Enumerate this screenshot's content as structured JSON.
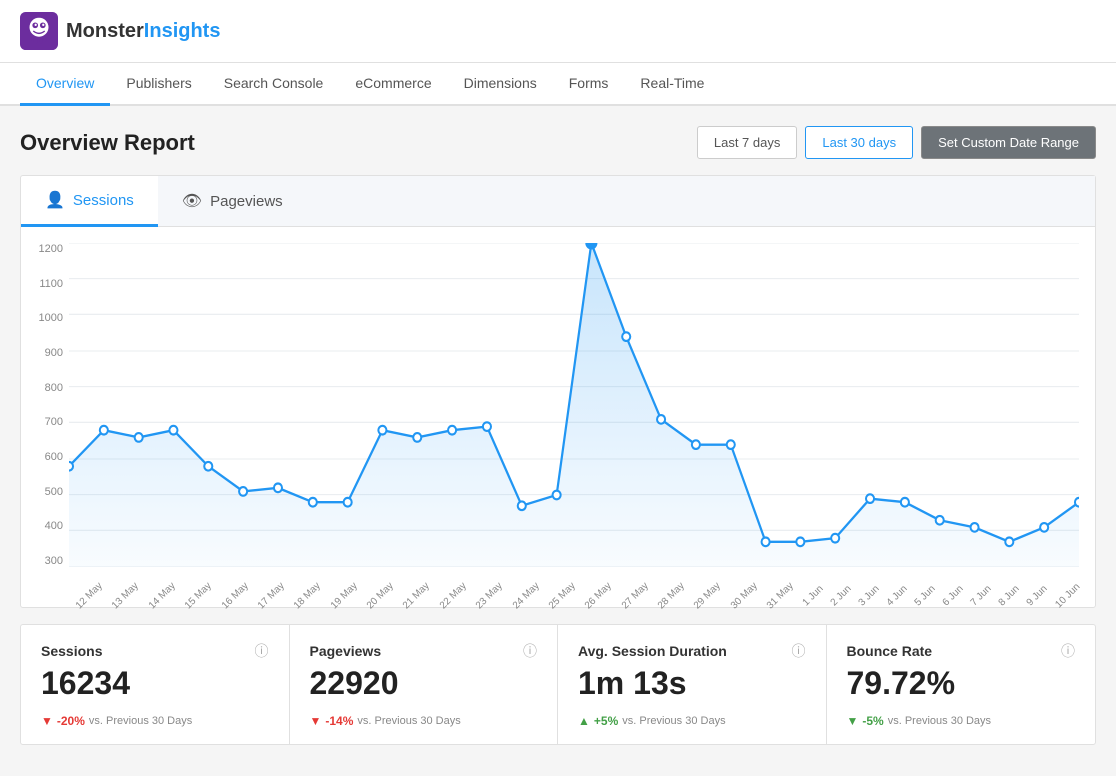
{
  "header": {
    "logo_monster": "Monster",
    "logo_insights": "Insights"
  },
  "nav": {
    "items": [
      {
        "id": "overview",
        "label": "Overview",
        "active": true
      },
      {
        "id": "publishers",
        "label": "Publishers",
        "active": false
      },
      {
        "id": "search-console",
        "label": "Search Console",
        "active": false
      },
      {
        "id": "ecommerce",
        "label": "eCommerce",
        "active": false
      },
      {
        "id": "dimensions",
        "label": "Dimensions",
        "active": false
      },
      {
        "id": "forms",
        "label": "Forms",
        "active": false
      },
      {
        "id": "real-time",
        "label": "Real-Time",
        "active": false
      }
    ]
  },
  "report": {
    "title": "Overview Report",
    "date_buttons": {
      "last7": "Last 7 days",
      "last30": "Last 30 days",
      "custom": "Set Custom Date Range"
    }
  },
  "chart": {
    "tab_sessions": "Sessions",
    "tab_pageviews": "Pageviews",
    "y_labels": [
      "1200",
      "1100",
      "1000",
      "900",
      "800",
      "700",
      "600",
      "500",
      "400",
      "300"
    ],
    "x_labels": [
      "12 May",
      "13 May",
      "14 May",
      "15 May",
      "16 May",
      "17 May",
      "18 May",
      "19 May",
      "20 May",
      "21 May",
      "22 May",
      "23 May",
      "24 May",
      "25 May",
      "26 May",
      "27 May",
      "28 May",
      "29 May",
      "30 May",
      "31 May",
      "1 Jun",
      "2 Jun",
      "3 Jun",
      "4 Jun",
      "5 Jun",
      "6 Jun",
      "7 Jun",
      "8 Jun",
      "9 Jun",
      "10 Jun"
    ]
  },
  "stats": [
    {
      "id": "sessions",
      "label": "Sessions",
      "value": "16234",
      "change": "-20%",
      "change_dir": "down",
      "vs_text": "vs. Previous 30 Days"
    },
    {
      "id": "pageviews",
      "label": "Pageviews",
      "value": "22920",
      "change": "-14%",
      "change_dir": "down",
      "vs_text": "vs. Previous 30 Days"
    },
    {
      "id": "avg-session",
      "label": "Avg. Session Duration",
      "value": "1m 13s",
      "change": "+5%",
      "change_dir": "up",
      "vs_text": "vs. Previous 30 Days"
    },
    {
      "id": "bounce-rate",
      "label": "Bounce Rate",
      "value": "79.72%",
      "change": "-5%",
      "change_dir": "up",
      "vs_text": "vs. Previous 30 Days"
    }
  ],
  "colors": {
    "accent": "#2196F3",
    "chart_line": "#2196F3",
    "chart_fill": "rgba(33,150,243,0.15)",
    "down": "#e53935",
    "up": "#43a047"
  }
}
